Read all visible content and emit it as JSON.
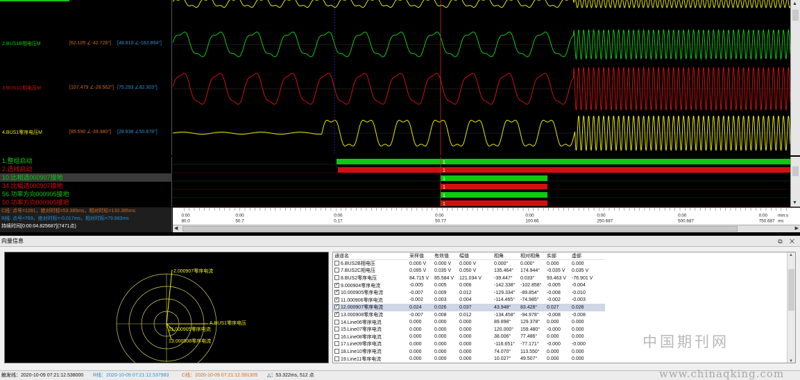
{
  "colors": {
    "yellow": "#e8e800",
    "green": "#11c811",
    "red": "#d01010",
    "orange_text": "#d2691e",
    "blue_text": "#2a8fd4"
  },
  "channels": [
    {
      "name": "2.BUS1B相电压M",
      "v1": "[62.105 ∠-42.728°]",
      "v2": "[48.810 ∠-162.894°]",
      "color": "green"
    },
    {
      "name": "3.BUS1C相电压M",
      "v1": "[107.479 ∠-28.562°]",
      "v2": "[75.293 ∠82.303°]",
      "color": "red"
    },
    {
      "name": "4.BUS1零序电压M",
      "v1": "[85.590 ∠-39.480°]",
      "v2": "[28.938 ∠50.878°]",
      "color": "yellow"
    }
  ],
  "digital": [
    {
      "label": "1.整组启动",
      "color": "green",
      "value": "1"
    },
    {
      "label": "2.选线启动",
      "color": "red",
      "value": "1"
    },
    {
      "label": "10.比相选000907接地",
      "color": "green",
      "value": "1"
    },
    {
      "label": "34.比幅选000907接地",
      "color": "red",
      "value": "1"
    },
    {
      "label": "56.功率方向000905接地",
      "color": "green",
      "value": "1"
    },
    {
      "label": "50.功率方向000905接地",
      "color": "red",
      "value": "1"
    }
  ],
  "cursor_info": {
    "c_line": "C线: 点号=1281，绝对时标=53.385ms，相对时标=133.385ms",
    "r_line": "R线: 点号=769，绝对时标=-0.017ms，相对时标=79.983ms",
    "duration": "持续时间[0:00:04.825687](7471点)"
  },
  "time_axis": {
    "top_labels": [
      "0:00",
      "0:00",
      "0:00",
      "0:00",
      "0:00",
      "0:00",
      "0:00",
      "0:00",
      "min:s"
    ],
    "bottom_labels": [
      "80.0",
      "50.7",
      "0.17",
      "50.77",
      "100.66",
      "250.687",
      "500.687",
      "750.687",
      "ms"
    ]
  },
  "vector_panel": {
    "title": "向量信息",
    "header_buttons": "⧉ ✕",
    "phasor_labels": [
      "2.000907零序电流",
      "A.BUS1零序电压",
      "11.000905零序电流",
      "13.000908零序电流"
    ],
    "table_headers": [
      "通道名",
      "采样值",
      "有效值",
      "幅值",
      "相角",
      "相对相角",
      "实部",
      "虚部"
    ],
    "rows": [
      {
        "checked": false,
        "name": "6.BUS2B相电压",
        "sample": "0.000 V",
        "rms": "0.000 V",
        "amp": "0.000 V",
        "angle": "0.000°",
        "rel": "0.000°",
        "re": "0.000",
        "im": "0.000"
      },
      {
        "checked": false,
        "name": "7.BUS2C相电压",
        "sample": "0.095 V",
        "rms": "0.035 V",
        "amp": "0.050 V",
        "angle": "135.464°",
        "rel": "174.944°",
        "re": "-0.035 V",
        "im": "0.035 V"
      },
      {
        "checked": false,
        "name": "8.BUS2零序电压",
        "sample": "84.715 V",
        "rms": "85.584 V",
        "amp": "121.034 V",
        "angle": "-39.447°",
        "rel": "0.033°",
        "re": "93.463 V",
        "im": "-76.901 V"
      },
      {
        "checked": true,
        "name": "9.000904零序电流",
        "sample": "-0.005",
        "rms": "0.005",
        "amp": "0.006",
        "angle": "-142.338°",
        "rel": "-102.858°",
        "re": "-0.005",
        "im": "-0.004"
      },
      {
        "checked": true,
        "name": "10.000905零序电流",
        "sample": "-0.007",
        "rms": "0.009",
        "amp": "0.012",
        "angle": "-129.334°",
        "rel": "-89.854°",
        "re": "-0.008",
        "im": "-0.010"
      },
      {
        "checked": true,
        "name": "11.000906零序电流",
        "sample": "-0.002",
        "rms": "0.003",
        "amp": "0.004",
        "angle": "-114.465°",
        "rel": "-74.985°",
        "re": "-0.002",
        "im": "-0.003"
      },
      {
        "checked": true,
        "name": "12.000907零序电流",
        "sample": "0.024",
        "rms": "0.026",
        "amp": "0.037",
        "angle": "43.948°",
        "rel": "83.428°",
        "re": "0.027",
        "im": "0.026",
        "highlight": true
      },
      {
        "checked": true,
        "name": "13.000908零序电流",
        "sample": "-0.007",
        "rms": "0.008",
        "amp": "0.012",
        "angle": "-134.458°",
        "rel": "-94.978°",
        "re": "-0.008",
        "im": "-0.008"
      },
      {
        "checked": false,
        "name": "14.Line06零序电流",
        "sample": "0.000",
        "rms": "0.000",
        "amp": "0.000",
        "angle": "89.898°",
        "rel": "129.378°",
        "re": "0.000",
        "im": "0.000"
      },
      {
        "checked": false,
        "name": "15.Line07零序电流",
        "sample": "0.000",
        "rms": "0.000",
        "amp": "0.000",
        "angle": "120.000°",
        "rel": "159.480°",
        "re": "-0.000",
        "im": "0.000"
      },
      {
        "checked": false,
        "name": "16.Line08零序电流",
        "sample": "0.000",
        "rms": "0.000",
        "amp": "0.000",
        "angle": "38.006°",
        "rel": "77.486°",
        "re": "0.000",
        "im": "0.000"
      },
      {
        "checked": false,
        "name": "17.Line09零序电流",
        "sample": "0.000",
        "rms": "0.000",
        "amp": "0.000",
        "angle": "-116.651°",
        "rel": "-77.171°",
        "re": "-0.000",
        "im": "-0.000"
      },
      {
        "checked": false,
        "name": "18.Line10零序电流",
        "sample": "0.000",
        "rms": "0.000",
        "amp": "0.000",
        "angle": "74.070°",
        "rel": "113.550°",
        "re": "0.000",
        "im": "0.000"
      },
      {
        "checked": false,
        "name": "19.Line11零序电流",
        "sample": "0.000",
        "rms": "0.000",
        "amp": "0.000",
        "angle": "10.027°",
        "rel": "49.507°",
        "re": "0.000",
        "im": "0.000"
      }
    ]
  },
  "status_bar": {
    "trigger": "触发线：2020-10-09 07:21:12.538000",
    "r_line": "R线：2020-10-09 07:21:12.537983",
    "c_line": "C线：2020-10-09 07:21:12.591305",
    "delta": "△：53.322ms, 512 点"
  },
  "watermark": {
    "text1": "中国期刊网",
    "text2": "www.chinaqking.com"
  }
}
